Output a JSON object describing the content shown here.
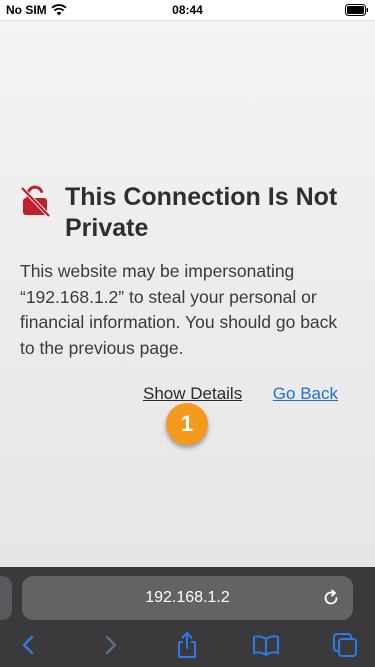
{
  "status_bar": {
    "carrier": "No SIM",
    "time": "08:44"
  },
  "error_page": {
    "title": "This Connection Is Not Private",
    "description": "This website may be impersonating “192.168.1.2” to steal your personal or financial information. You should go back to the previous page.",
    "show_details_label": "Show Details",
    "go_back_label": "Go Back"
  },
  "annotation": {
    "marker_number": "1"
  },
  "browser": {
    "address": "192.168.1.2"
  },
  "colors": {
    "accent_link": "#1f6fe0",
    "warning_icon": "#c0202e",
    "marker": "#f39a1e",
    "toolbar_icons": "#2c7be5"
  }
}
